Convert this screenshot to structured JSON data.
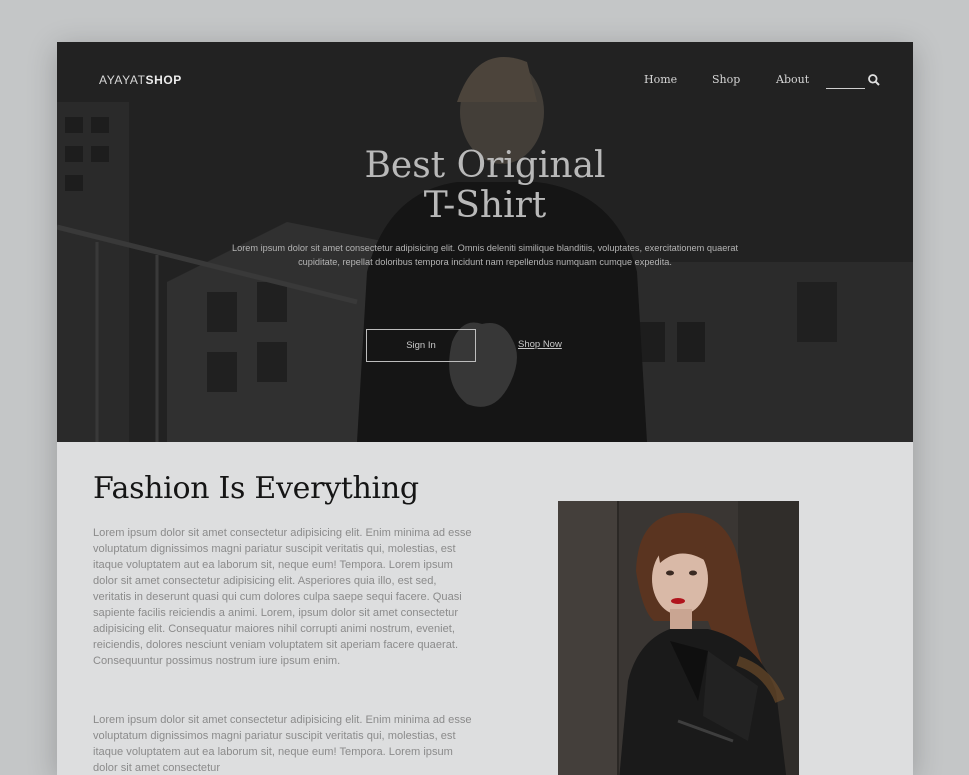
{
  "brand": {
    "light": "AYAYAT",
    "bold": "SHOP"
  },
  "nav": {
    "home": "Home",
    "shop": "Shop",
    "about": "About"
  },
  "search": {
    "icon": "search-icon"
  },
  "hero": {
    "title_line1": "Best Original",
    "title_line2": "T-Shirt",
    "subtitle": "Lorem ipsum dolor sit amet consectetur adipisicing elit. Omnis deleniti similique blanditiis, voluptates, exercitationem quaerat cupiditate, repellat doloribus tempora incidunt nam repellendus numquam cumque expedita.",
    "signin_label": "Sign In",
    "shopnow_label": "Shop Now"
  },
  "section": {
    "title": "Fashion Is Everything",
    "paragraph1": "Lorem ipsum dolor sit amet consectetur adipisicing elit. Enim minima ad esse voluptatum dignissimos magni pariatur suscipit veritatis qui, molestias, est itaque voluptatem aut ea laborum sit, neque eum! Tempora. Lorem ipsum dolor sit amet consectetur adipisicing elit. Asperiores quia illo, est sed, veritatis in deserunt quasi qui cum dolores culpa saepe sequi facere. Quasi sapiente facilis reiciendis a animi. Lorem, ipsum dolor sit amet consectetur adipisicing elit. Consequatur maiores nihil corrupti animi nostrum, eveniet, reiciendis, dolores nesciunt veniam voluptatem sit aperiam facere quaerat. Consequuntur possimus nostrum iure ipsum enim.",
    "paragraph2": "Lorem ipsum dolor sit amet consectetur adipisicing elit. Enim minima ad esse voluptatum dignissimos magni pariatur suscipit veritatis qui, molestias, est itaque voluptatem aut ea laborum sit, neque eum! Tempora. Lorem ipsum dolor sit amet consectetur"
  },
  "colors": {
    "page_bg": "#c4c6c7",
    "content_bg": "#dddedf",
    "hero_dark": "#262626",
    "heading": "#151515",
    "body_text": "#8b8b8b"
  }
}
